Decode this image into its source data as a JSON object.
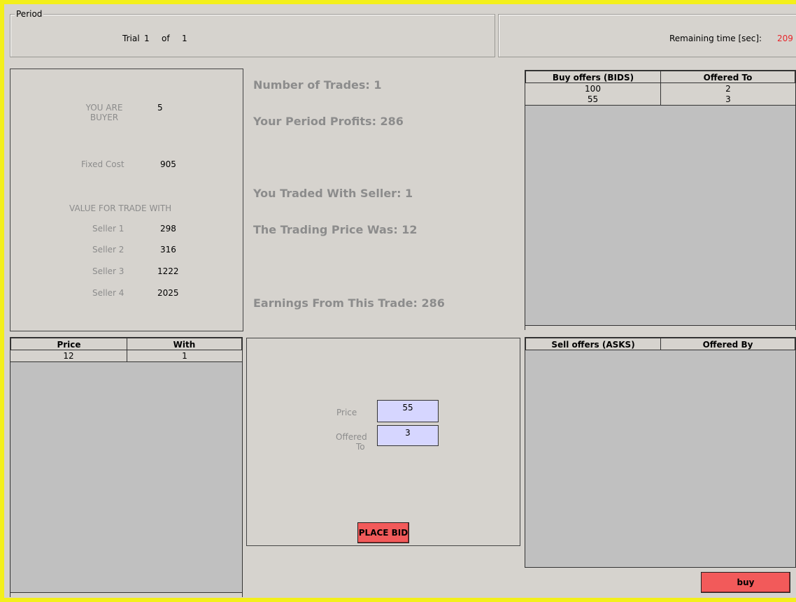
{
  "period": {
    "group_label": "Period",
    "trial_label": "Trial",
    "trial_current": "1",
    "of_label": "of",
    "trial_total": "1",
    "remaining_label": "Remaining time [sec]:",
    "remaining_value": "209"
  },
  "buyer_info": {
    "role_line1": "YOU ARE",
    "role_line2": "BUYER",
    "buyer_number": "5",
    "fixed_cost_label": "Fixed Cost",
    "fixed_cost_value": "905",
    "value_header": "VALUE FOR TRADE WITH",
    "sellers": [
      {
        "label": "Seller 1",
        "value": "298"
      },
      {
        "label": "Seller 2",
        "value": "316"
      },
      {
        "label": "Seller 3",
        "value": "1222"
      },
      {
        "label": "Seller 4",
        "value": "2025"
      }
    ]
  },
  "summary": {
    "number_of_trades": "Number of Trades: 1",
    "period_profits": "Your Period Profits: 286",
    "traded_with": "You Traded With Seller: 1",
    "trading_price": "The Trading Price Was: 12",
    "earnings": "Earnings From This Trade: 286"
  },
  "bids_table": {
    "headers": [
      "Buy offers (BIDS)",
      "Offered To"
    ],
    "rows": [
      [
        "100",
        "2"
      ],
      [
        "55",
        "3"
      ]
    ]
  },
  "trades_table": {
    "headers": [
      "Price",
      "With"
    ],
    "rows": [
      [
        "12",
        "1"
      ]
    ]
  },
  "bid_form": {
    "price_label": "Price",
    "price_value": "55",
    "offered_label_line1": "Offered",
    "offered_label_line2": "To",
    "offered_value": "3",
    "place_bid_label": "PLACE BID"
  },
  "asks_table": {
    "headers": [
      "Sell offers (ASKS)",
      "Offered By"
    ],
    "rows": []
  },
  "buy_button_label": "buy",
  "colors": {
    "background": "#d6d3ce",
    "border_highlight": "#f3ef1a",
    "remaining_time": "#e8262b",
    "button_red": "#f25a5a",
    "input_bg": "#d6d6ff"
  }
}
